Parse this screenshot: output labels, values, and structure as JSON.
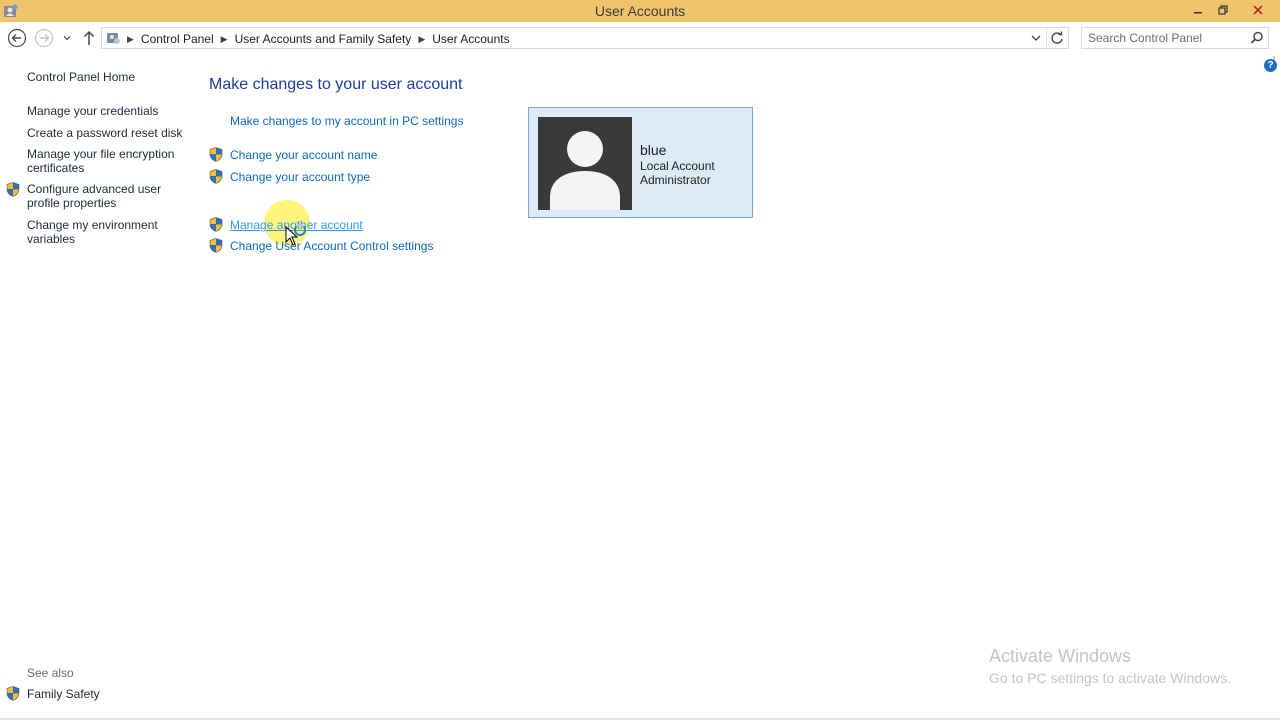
{
  "window": {
    "title": "User Accounts",
    "controls": [
      "minimize",
      "restore",
      "close"
    ],
    "app_icon": "user-accounts-icon"
  },
  "address_bar": {
    "breadcrumbs": [
      "Control Panel",
      "User Accounts and Family Safety",
      "User Accounts"
    ],
    "search_placeholder": "Search Control Panel"
  },
  "left_pane": {
    "home": "Control Panel Home",
    "links": [
      {
        "label": "Manage your credentials",
        "shield": false
      },
      {
        "label": "Create a password reset disk",
        "shield": false
      },
      {
        "label": "Manage your file encryption certificates",
        "shield": false
      },
      {
        "label": "Configure advanced user profile properties",
        "shield": true
      },
      {
        "label": "Change my environment variables",
        "shield": false
      }
    ],
    "see_also_title": "See also",
    "see_also_links": [
      {
        "label": "Family Safety",
        "shield": true
      }
    ]
  },
  "main": {
    "heading": "Make changes to your user account",
    "links": [
      {
        "label": "Make changes to my account in PC settings",
        "shield": false
      },
      {
        "label": "Change your account name",
        "shield": true
      },
      {
        "label": "Change your account type",
        "shield": true
      },
      {
        "label": "Manage another account",
        "shield": true
      },
      {
        "label": "Change User Account Control settings",
        "shield": true
      }
    ]
  },
  "account": {
    "name": "blue",
    "type": "Local Account",
    "role": "Administrator"
  },
  "watermark": {
    "title": "Activate Windows",
    "subtitle": "Go to PC settings to activate Windows."
  },
  "colors": {
    "titlebar": "#f0c46a",
    "link": "#0a6bc4",
    "heading": "#1c3f94",
    "tile_bg": "#dcebf8",
    "tile_border": "#7aa7d8"
  }
}
